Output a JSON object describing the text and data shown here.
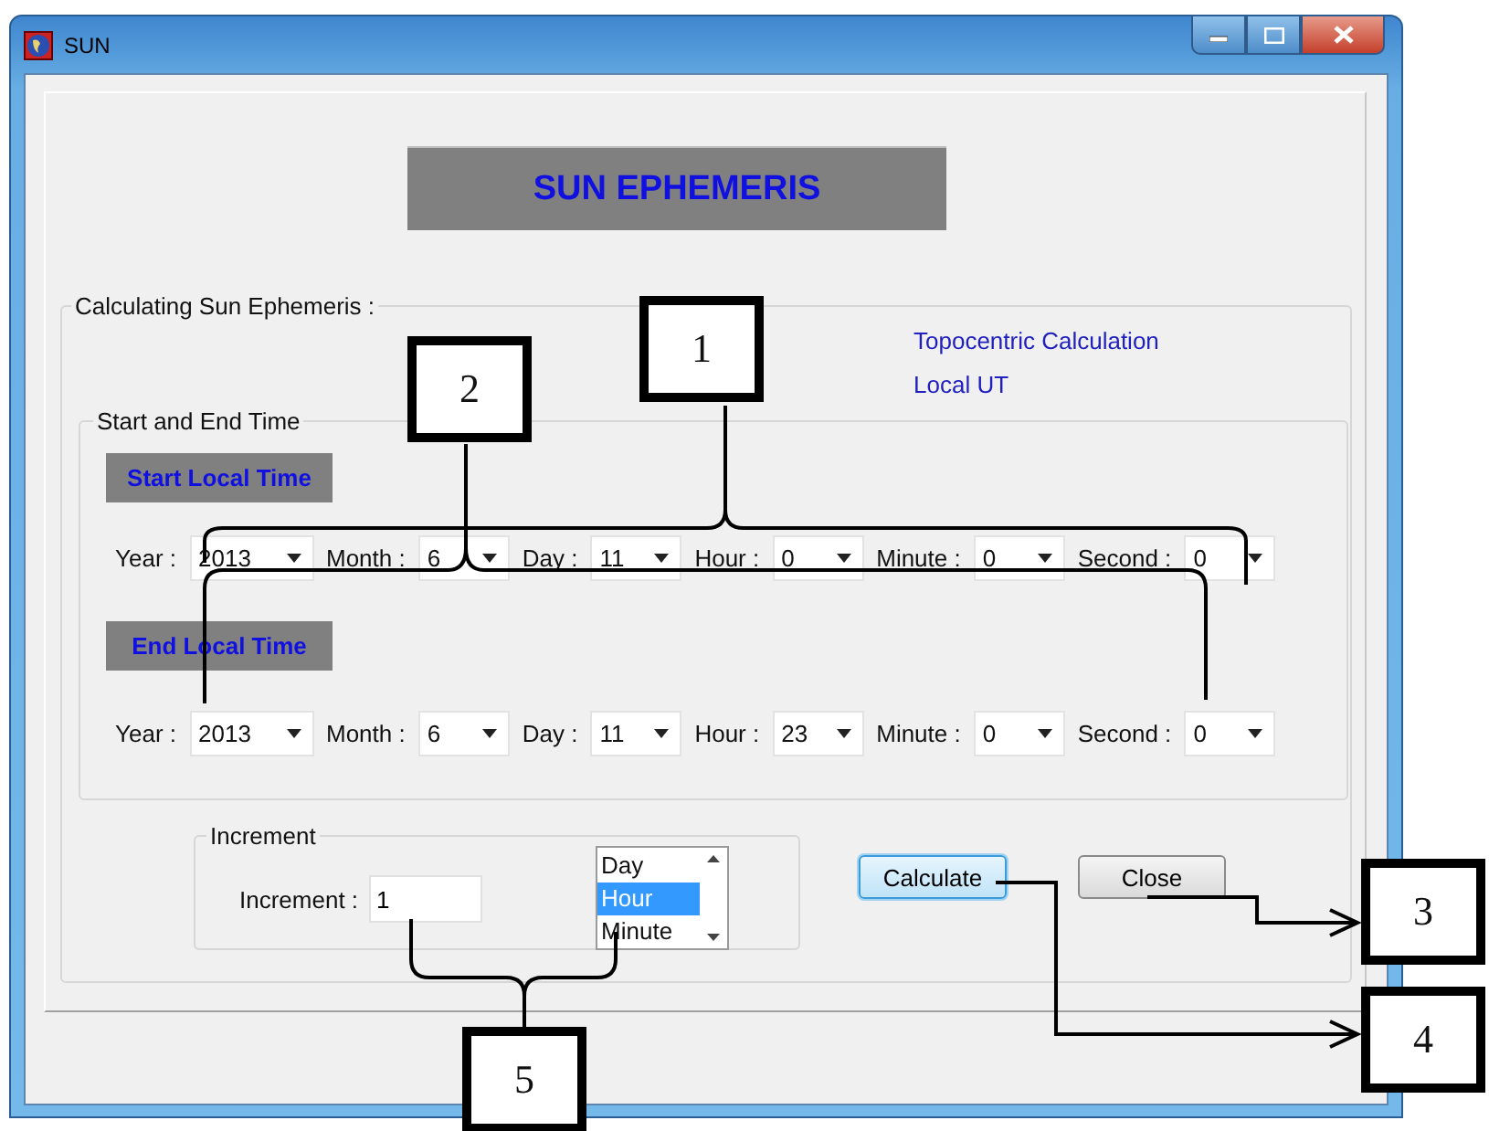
{
  "window": {
    "title": "SUN"
  },
  "banner": "SUN EPHEMERIS",
  "calculation_group": {
    "legend": "Calculating Sun Ephemeris :",
    "info": [
      "Topocentric Calculation",
      "Local UT"
    ]
  },
  "time_group": {
    "legend": "Start and End Time",
    "sections": [
      {
        "heading": "Start Local Time",
        "fields": [
          {
            "label": "Year :",
            "value": "2013"
          },
          {
            "label": "Month :",
            "value": "6"
          },
          {
            "label": "Day :",
            "value": "11"
          },
          {
            "label": "Hour :",
            "value": "0"
          },
          {
            "label": "Minute :",
            "value": "0"
          },
          {
            "label": "Second :",
            "value": "0"
          }
        ]
      },
      {
        "heading": "End Local Time",
        "fields": [
          {
            "label": "Year :",
            "value": "2013"
          },
          {
            "label": "Month :",
            "value": "6"
          },
          {
            "label": "Day :",
            "value": "11"
          },
          {
            "label": "Hour :",
            "value": "23"
          },
          {
            "label": "Minute :",
            "value": "0"
          },
          {
            "label": "Second :",
            "value": "0"
          }
        ]
      }
    ]
  },
  "increment_group": {
    "legend": "Increment",
    "label": "Increment :",
    "value": "1",
    "units": [
      {
        "label": "Day",
        "selected": false
      },
      {
        "label": "Hour",
        "selected": true
      },
      {
        "label": "Minute",
        "selected": false
      }
    ]
  },
  "buttons": [
    {
      "label": "Calculate",
      "default": true
    },
    {
      "label": "Close",
      "default": false
    }
  ],
  "annotations": [
    "1",
    "2",
    "3",
    "4",
    "5"
  ]
}
